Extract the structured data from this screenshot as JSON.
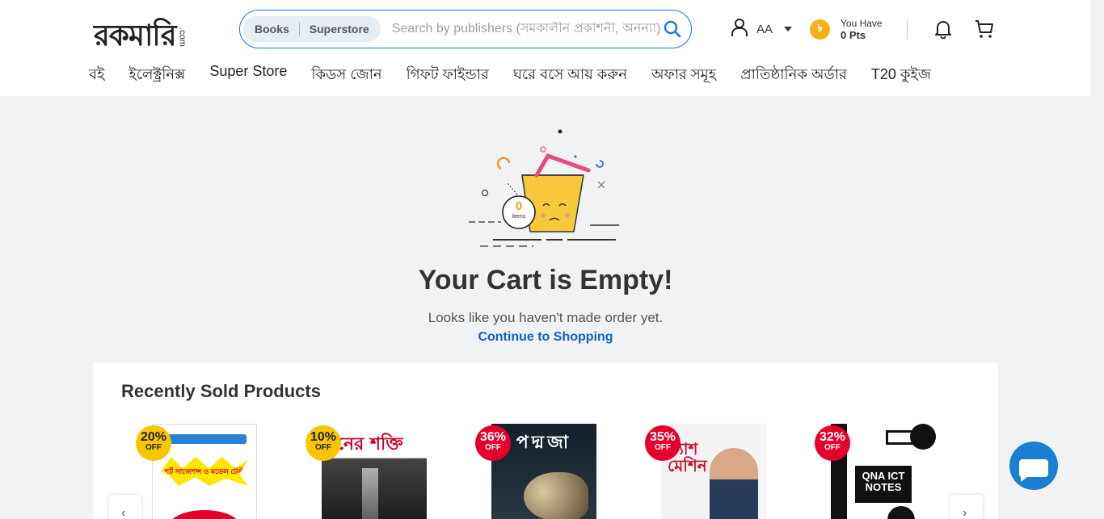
{
  "logo": {
    "main": "রকমারি",
    "suffix": ".com"
  },
  "search": {
    "tabs": [
      "Books",
      "Superstore"
    ],
    "placeholder": "Search by publishers (সমকালীন প্রকাশনী, অনন্যা)"
  },
  "user": {
    "name": "AA"
  },
  "points": {
    "label": "You Have",
    "value": "0 Pts"
  },
  "nav": [
    "বই",
    "ইলেক্ট্রনিক্স",
    "Super Store",
    "কিডস জোন",
    "গিফট ফাইন্ডার",
    "ঘরে বসে আয় করুন",
    "অফার সমূহ",
    "প্রাতিষ্ঠানিক অর্ডার",
    "T20 কুইজ"
  ],
  "empty_cart": {
    "count": "0",
    "count_label": "items",
    "title": "Your Cart is Empty!",
    "subtitle": "Looks like you haven't made order yet.",
    "link": "Continue to Shopping"
  },
  "recent": {
    "title": "Recently Sold Products",
    "products": [
      {
        "discount": "20%",
        "off": "OFF",
        "badge_color": "#f7c600",
        "cover_color": "#ffffff",
        "cover_title": "শর্ট সাজেশন্স ও মডেল টেস্ট"
      },
      {
        "discount": "10%",
        "off": "OFF",
        "badge_color": "#f7c600",
        "cover_color": "#1a1a1a",
        "cover_title": "মনের শক্তি"
      },
      {
        "discount": "36%",
        "off": "OFF",
        "badge_color": "#e4002b",
        "cover_color": "#1f2a35",
        "cover_title": "পদ্মজা"
      },
      {
        "discount": "35%",
        "off": "OFF",
        "badge_color": "#e4002b",
        "cover_color": "#f5f5f5",
        "cover_title": "ক্যাশ মেশিন"
      },
      {
        "discount": "32%",
        "off": "OFF",
        "badge_color": "#e4002b",
        "cover_color": "#111111",
        "cover_title": "QNA ICT NOTES"
      }
    ]
  },
  "colors": {
    "accent": "#1a73e8",
    "link": "#0a63c9",
    "coin": "#f6b11a",
    "chat": "#1a7fd0"
  }
}
